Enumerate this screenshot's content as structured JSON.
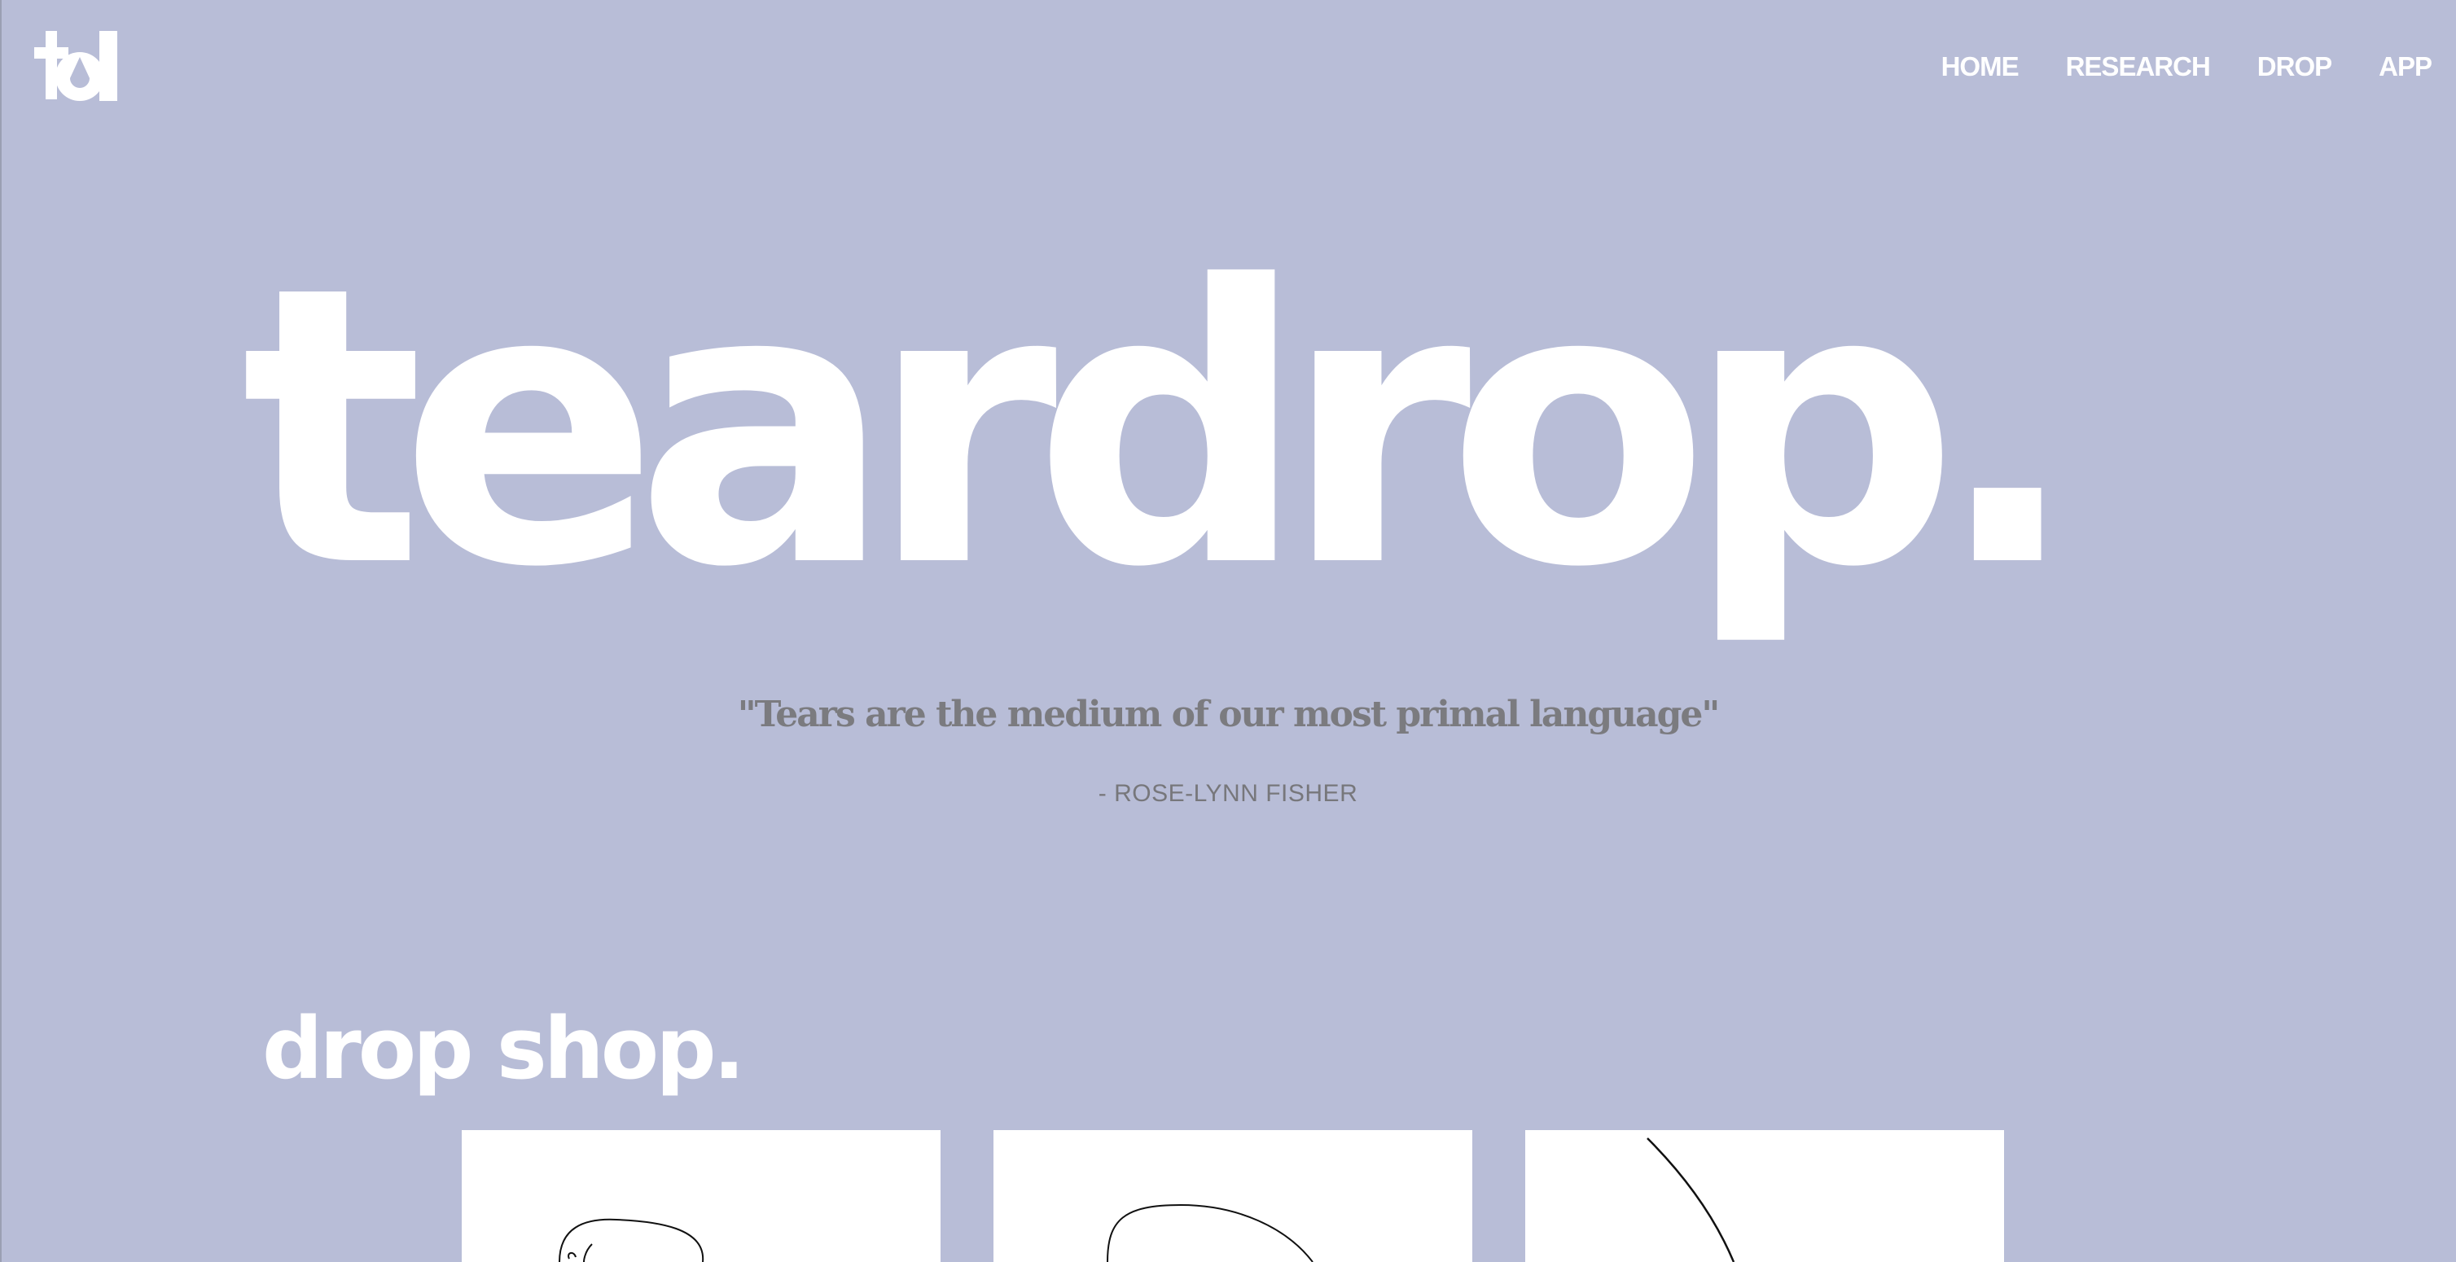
{
  "brand": {
    "logo_alt": "td",
    "accent_background": "#b8bdd7",
    "text_color": "#ffffff"
  },
  "nav": {
    "items": [
      {
        "label": "HOME"
      },
      {
        "label": "RESEARCH"
      },
      {
        "label": "DROP"
      },
      {
        "label": "APP"
      }
    ]
  },
  "hero": {
    "wordmark": "teardrop."
  },
  "quote": {
    "text": "\"Tears are the medium of our most primal language\"",
    "attribution": "- ROSE-LYNN FISHER"
  },
  "shop": {
    "title": "drop shop.",
    "products": [
      {
        "icon": "line-art-sketch-icon"
      },
      {
        "icon": "line-art-curve-icon"
      },
      {
        "icon": "line-art-stroke-icon"
      }
    ]
  }
}
